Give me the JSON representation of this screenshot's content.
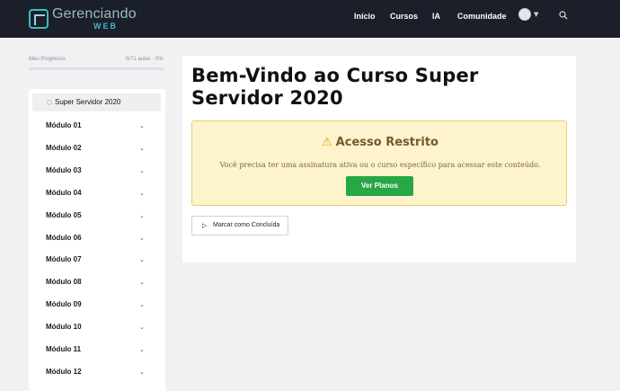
{
  "header": {
    "logo_title": "Gerenciando",
    "logo_sub": "WEB",
    "nav": [
      {
        "label": "Início"
      },
      {
        "label": "Cursos"
      },
      {
        "label": "IA"
      },
      {
        "label": "Comunidade"
      }
    ]
  },
  "progress": {
    "label": "Meu Progresso",
    "count": "0/71 aulas · 0%",
    "fraction": 0
  },
  "sidebar": {
    "course": "Super Servidor 2020",
    "modules": [
      {
        "label": "Módulo 01"
      },
      {
        "label": "Módulo 02"
      },
      {
        "label": "Módulo 03"
      },
      {
        "label": "Módulo 04"
      },
      {
        "label": "Módulo 05"
      },
      {
        "label": "Módulo 06"
      },
      {
        "label": "Módulo 07"
      },
      {
        "label": "Módulo 08"
      },
      {
        "label": "Módulo 09"
      },
      {
        "label": "Módulo 10"
      },
      {
        "label": "Módulo 11"
      },
      {
        "label": "Módulo 12"
      }
    ]
  },
  "main": {
    "title": "Bem-Vindo ao Curso Super Servidor 2020",
    "alert": {
      "icon": "warning-icon",
      "title": "Acesso Restrito",
      "text": "Você precisa ter uma assinatura ativa ou o curso específico para acessar este conteúdo.",
      "button": "Ver Planos"
    },
    "complete_button": "Marcar como Concluída"
  },
  "colors": {
    "header_bg": "#1b1f2a",
    "accent": "#3fb8c9",
    "alert_bg": "#fdf3cd",
    "alert_border": "#e9cf6b",
    "button_green": "#28a745"
  }
}
